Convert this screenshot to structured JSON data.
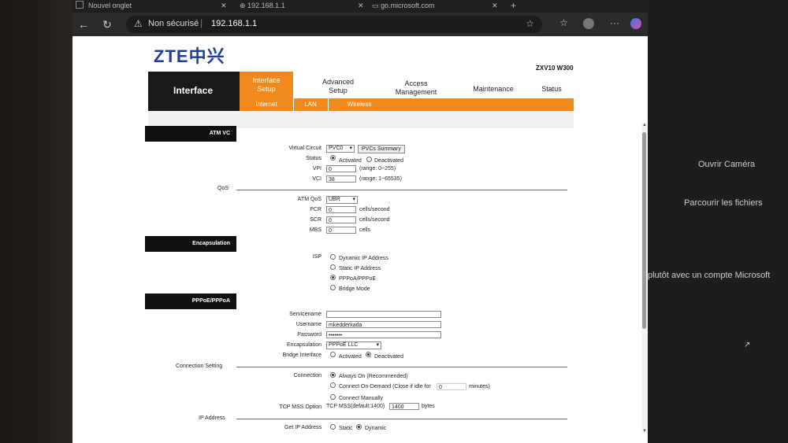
{
  "browser": {
    "tabs": [
      "Nouvel onglet",
      "192.168.1.1",
      "go.microsoft.com"
    ],
    "security": "Non sécurisé",
    "separator": "|",
    "url": "192.168.1.1",
    "new_tab_symbol": "+"
  },
  "side_panel": {
    "camera": "Ouvrir Caméra",
    "files": "Parcourir les fichiers",
    "account": "plutôt avec un compte Microsoft"
  },
  "page": {
    "logo_latin": "ZTE",
    "logo_cn": "中兴",
    "model": "ZXV10 W300",
    "section": "Interface",
    "nav": [
      {
        "line1": "Interface",
        "line2": "Setup"
      },
      {
        "line1": "Advanced",
        "line2": "Setup"
      },
      {
        "line1": "Access",
        "line2": "Management"
      },
      {
        "line1": "Maintenance",
        "line2": ""
      },
      {
        "line1": "Status",
        "line2": ""
      }
    ],
    "subnav": [
      "Internet",
      "LAN",
      "Wireless"
    ]
  },
  "atm": {
    "header": "ATM VC",
    "virtual_circuit_label": "Virtual Circuit",
    "virtual_circuit_value": "PVC0",
    "pvcs_summary": "PVCs Summary",
    "status_label": "Status",
    "activated": "Activated",
    "deactivated": "Deactivated",
    "vpi_label": "VPI",
    "vpi_value": "0",
    "vpi_range": "(range: 0~255)",
    "vci_label": "VCI",
    "vci_value": "38",
    "vci_range": "(range: 1~65535)"
  },
  "qos": {
    "header": "QoS",
    "atm_qos_label": "ATM QoS",
    "atm_qos_value": "UBR",
    "pcr_label": "PCR",
    "pcr_value": "0",
    "scr_label": "SCR",
    "scr_value": "0",
    "mbs_label": "MBS",
    "mbs_value": "0",
    "cells_per_second": "cells/second",
    "cells": "cells"
  },
  "encap": {
    "header": "Encapsulation",
    "isp_label": "ISP",
    "options": [
      "Dynamic IP Address",
      "Static IP Address",
      "PPPoA/PPPoE",
      "Bridge Mode"
    ]
  },
  "pppoe": {
    "header": "PPPoE/PPPoA",
    "servicename_label": "Servicename",
    "servicename_value": "",
    "username_label": "Username",
    "username_value": "mkedderkada",
    "password_label": "Password",
    "password_value": "•••••••",
    "encapsulation_label": "Encapsulation",
    "encapsulation_value": "PPPoE LLC",
    "bridge_label": "Bridge Interface",
    "activated": "Activated",
    "deactivated": "Deactivated"
  },
  "connection": {
    "header": "Connection Setting",
    "connection_label": "Connection",
    "always_on": "Always On (Recommended)",
    "on_demand": "Connect On-Demand (Close if idle for",
    "idle_value": "0",
    "minutes": "minutes)",
    "manually": "Connect Manually",
    "mss_label": "TCP MSS Option",
    "mss_text": "TCP MSS(default:1400)",
    "mss_value": "1400",
    "bytes": "bytes"
  },
  "ip": {
    "header": "IP Address",
    "get_ip_label": "Get IP Address",
    "static": "Static",
    "dynamic": "Dynamic"
  },
  "colors": {
    "accent": "#f08a1c",
    "logo": "#1e3e9c",
    "header": "#111111"
  }
}
